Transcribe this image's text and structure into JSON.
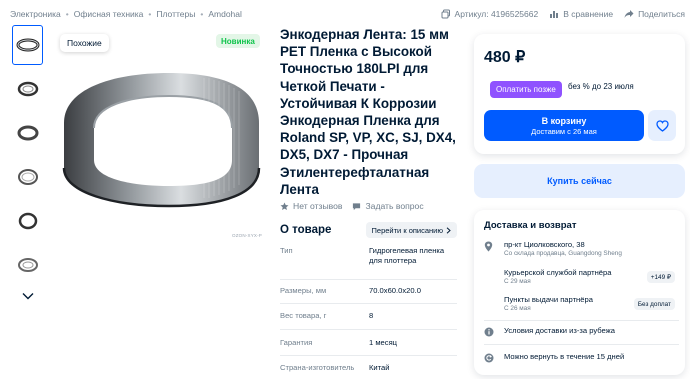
{
  "breadcrumbs": [
    "Электроника",
    "Офисная техника",
    "Плоттеры",
    "Amdohal"
  ],
  "top_actions": {
    "article": "Артикул: 4196525662",
    "compare": "В сравнение",
    "share": "Поделиться"
  },
  "gallery": {
    "similar_label": "Похожие",
    "new_badge": "Новинка",
    "watermark": "OZON-XYX-P"
  },
  "product": {
    "title": "Энкодерная Лента: 15 мм PET Пленка с Высокой Точностью 180LPI для Четкой Печати - Устойчивая К Коррозии Энкодерная Пленка для Roland SP, VP, XC, SJ, DX4, DX5, DX7 - Прочная Этилентерефталатная Лента",
    "reviews": "Нет отзывов",
    "ask": "Задать вопрос"
  },
  "about": {
    "title": "О товаре",
    "link": "Перейти к описанию",
    "specs": [
      {
        "k": "Тип",
        "v": "Гидрогелевая пленка для плоттера"
      },
      {
        "k": "Размеры, мм",
        "v": "70.0x60.0x20.0"
      },
      {
        "k": "Вес товара, г",
        "v": "8"
      },
      {
        "k": "Гарантия",
        "v": "1 месяц"
      },
      {
        "k": "Страна-изготовитель",
        "v": "Китай"
      }
    ]
  },
  "buy": {
    "price": "480 ₽",
    "pay_later": "Оплатить позже",
    "no_interest": "без % до 23 июля",
    "cart_label": "В корзину",
    "cart_sub": "Доставим с 26 мая",
    "buy_now": "Купить сейчас"
  },
  "delivery": {
    "title": "Доставка и возврат",
    "address": "пр-кт Циолковского, 38",
    "warehouse": "Со склада продавца, Guangdong Sheng",
    "courier": "Курьерской службой партнёра",
    "courier_date": "С 29 мая",
    "courier_price": "+149 ₽",
    "pickup": "Пункты выдачи партнёра",
    "pickup_date": "С 26 мая",
    "pickup_price": "Без доплат",
    "conditions": "Условия доставки из-за рубежа",
    "return": "Можно вернуть в течение 15 дней"
  },
  "colors": {
    "accent": "#005bff",
    "paylater": "#8f52ff",
    "new_badge": "#10c44c"
  }
}
